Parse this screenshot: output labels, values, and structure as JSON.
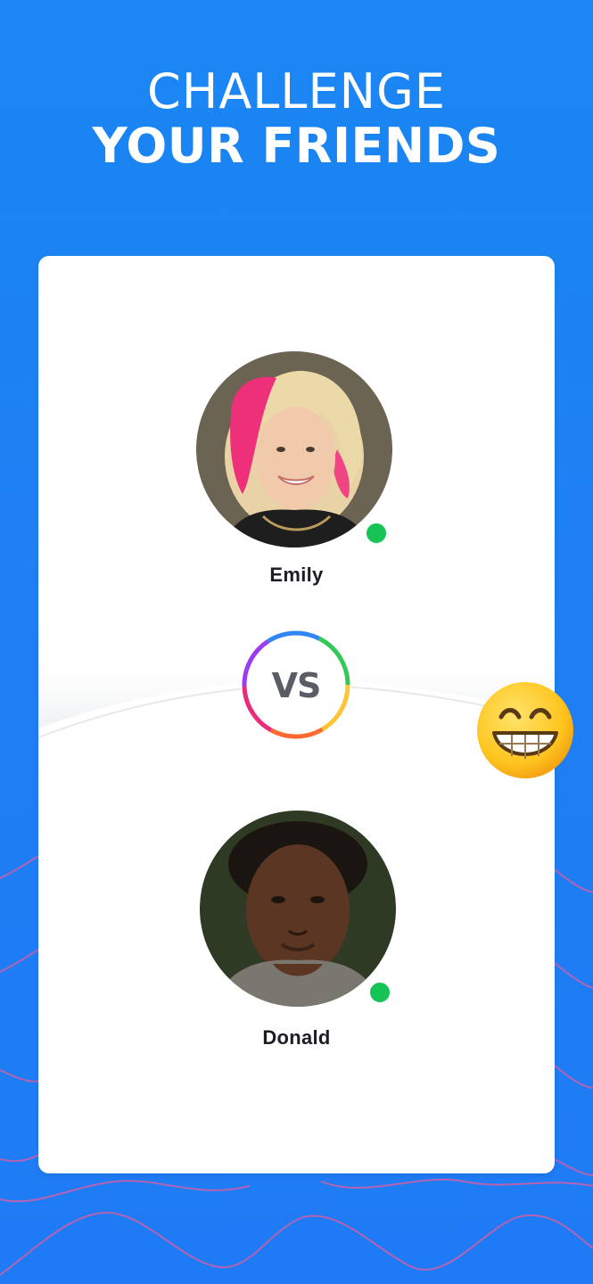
{
  "headline": {
    "line1": "CHALLENGE",
    "line2": "YOUR FRIENDS"
  },
  "players": [
    {
      "name": "Emily",
      "status": "online"
    },
    {
      "name": "Donald",
      "status": "online"
    }
  ],
  "versus": {
    "label": "VS"
  },
  "emoji": {
    "icon": "grinning-face-icon"
  },
  "colors": {
    "background": "#1e7ff4",
    "card": "#ffffff",
    "online": "#16c455",
    "wave": "#e2629a"
  }
}
